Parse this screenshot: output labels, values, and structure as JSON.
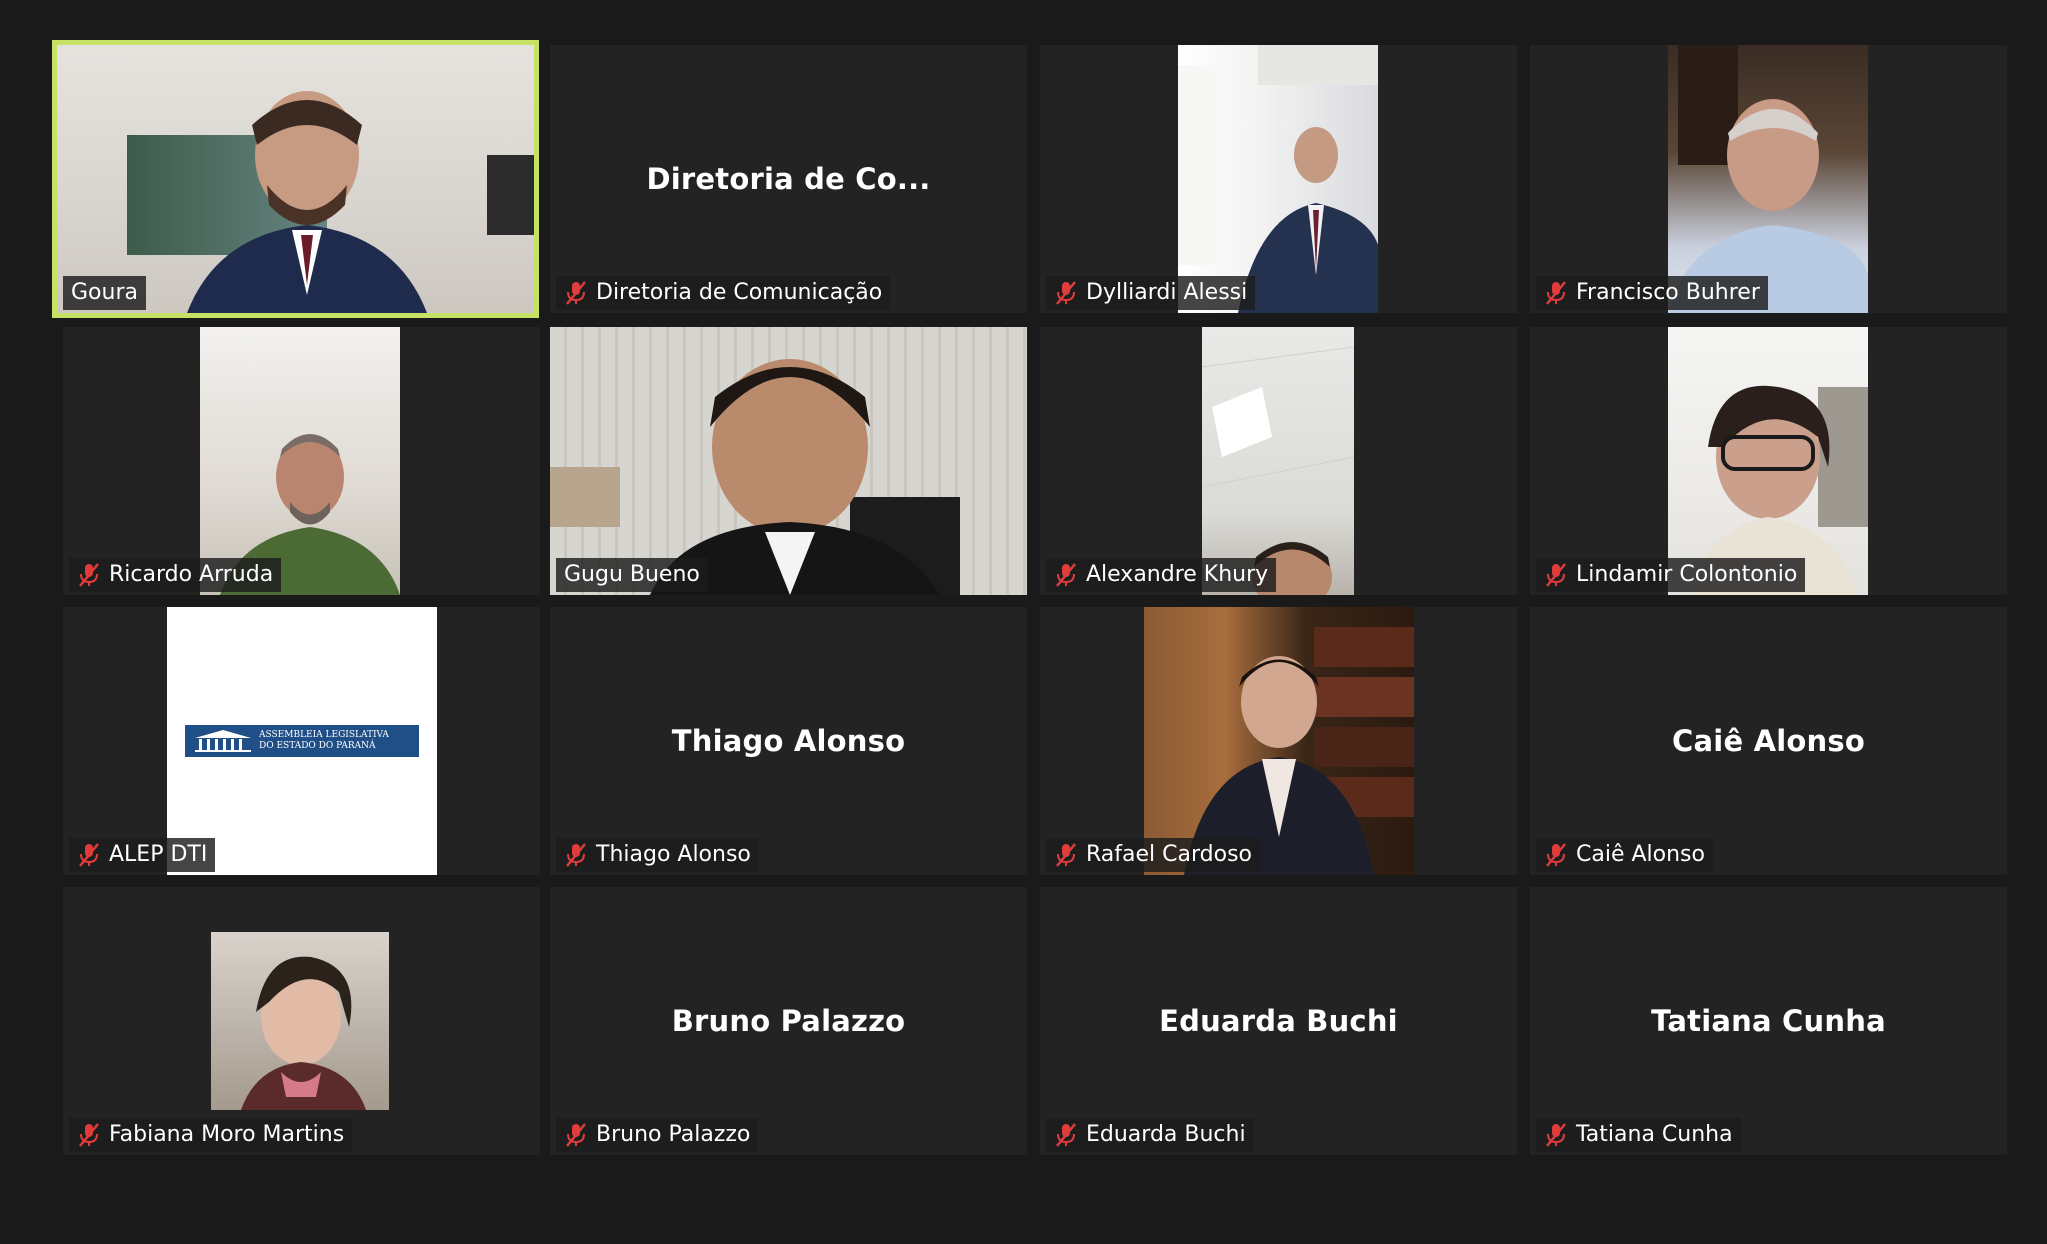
{
  "meeting": {
    "mute_icon": "muted-microphone-icon",
    "accent_speaking": "#c7e066",
    "mute_color": "#e03c3c"
  },
  "participants": [
    {
      "label": "Goura",
      "muted": false,
      "video": true,
      "speaking": true
    },
    {
      "label": "Diretoria de Comunicação",
      "center_name": "Diretoria de Co...",
      "muted": true,
      "video": false
    },
    {
      "label": "Dylliardi Alessi",
      "muted": true,
      "video": true
    },
    {
      "label": "Francisco Buhrer",
      "muted": true,
      "video": true
    },
    {
      "label": "Ricardo Arruda",
      "muted": true,
      "video": true
    },
    {
      "label": "Gugu Bueno",
      "muted": false,
      "video": true
    },
    {
      "label": "Alexandre Khury",
      "muted": true,
      "video": true
    },
    {
      "label": "Lindamir Colontonio",
      "muted": true,
      "video": true
    },
    {
      "label": "ALEP DTI",
      "muted": true,
      "video": true,
      "logo": {
        "line1": "ASSEMBLEIA LEGISLATIVA",
        "line2": "DO ESTADO DO PARANÁ"
      }
    },
    {
      "label": "Thiago Alonso",
      "center_name": "Thiago Alonso",
      "muted": true,
      "video": false
    },
    {
      "label": "Rafael Cardoso",
      "muted": true,
      "video": true
    },
    {
      "label": "Caiê Alonso",
      "center_name": "Caiê Alonso",
      "muted": true,
      "video": false
    },
    {
      "label": "Fabiana Moro Martins",
      "muted": true,
      "video": true
    },
    {
      "label": "Bruno Palazzo",
      "center_name": "Bruno Palazzo",
      "muted": true,
      "video": false
    },
    {
      "label": "Eduarda Buchi",
      "center_name": "Eduarda Buchi",
      "muted": true,
      "video": false
    },
    {
      "label": "Tatiana Cunha",
      "center_name": "Tatiana Cunha",
      "muted": true,
      "video": false
    }
  ]
}
